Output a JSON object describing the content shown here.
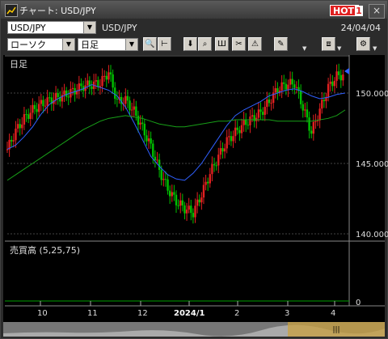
{
  "window": {
    "title": "チャート: USD/JPY",
    "hot_label": "HOT",
    "hot_num": "1",
    "close_glyph": "×"
  },
  "header": {
    "symbol_select": "USD/JPY",
    "symbol_text": "USD/JPY",
    "date": "24/04/04"
  },
  "toolbar": {
    "chart_type": "ローソク",
    "period": "日足"
  },
  "price_panel": {
    "label": "日足",
    "y_ticks": [
      "150.000",
      "145.000",
      "140.000"
    ]
  },
  "volume_panel": {
    "label": "売買高 (5,25,75)",
    "y_tick": "0"
  },
  "x_axis": {
    "ticks": [
      "10",
      "11",
      "12",
      "2024/1",
      "2",
      "3",
      "4"
    ]
  },
  "colors": {
    "up": "#e02020",
    "down": "#00c000",
    "ma_short": "#3060ff",
    "ma_long": "#18a018",
    "background": "#000000"
  },
  "chart_data": {
    "type": "candlestick",
    "ylim": [
      140,
      152
    ],
    "x_ticks": [
      "10",
      "11",
      "12",
      "2024/1",
      "2",
      "3",
      "4"
    ],
    "series": [
      {
        "values": [
          146.0,
          147.3,
          148.2,
          148.8,
          149.2,
          149.5,
          149.7,
          149.9,
          150.2,
          150.5,
          150.6,
          150.7,
          151.5,
          149.4,
          149.5,
          148.7,
          147.5,
          146.2,
          144.5,
          143.2,
          142.3,
          141.8,
          141.5,
          142.8,
          144.3,
          145.5,
          146.6,
          147.2,
          147.8,
          148.2,
          148.6,
          149.4,
          150.3,
          150.6,
          150.7,
          149.0,
          147.2,
          148.8,
          150.4,
          151.2,
          151.3
        ]
      },
      {
        "values": [
          146.0,
          146.3,
          146.9,
          147.6,
          148.5,
          149.2,
          149.6,
          149.9,
          150.1,
          150.3,
          150.6,
          150.4,
          150.2,
          149.8,
          149.0,
          147.9,
          146.7,
          145.5,
          144.8,
          144.2,
          143.9,
          143.8,
          144.3,
          145.0,
          145.9,
          146.8,
          147.7,
          148.4,
          148.8,
          149.1,
          149.4,
          149.8,
          150.0,
          150.2,
          150.3,
          150.1,
          149.8,
          149.6,
          149.7,
          149.9,
          150.0
        ]
      },
      {
        "values": [
          143.8,
          144.2,
          144.6,
          145.0,
          145.4,
          145.8,
          146.2,
          146.6,
          147.0,
          147.4,
          147.7,
          148.0,
          148.2,
          148.3,
          148.4,
          148.3,
          148.2,
          148.0,
          147.8,
          147.7,
          147.6,
          147.6,
          147.7,
          147.8,
          147.9,
          148.0,
          148.0,
          148.1,
          148.1,
          148.1,
          148.1,
          148.1,
          148.0,
          148.0,
          148.0,
          148.0,
          148.0,
          148.1,
          148.2,
          148.4,
          148.8
        ]
      }
    ]
  }
}
